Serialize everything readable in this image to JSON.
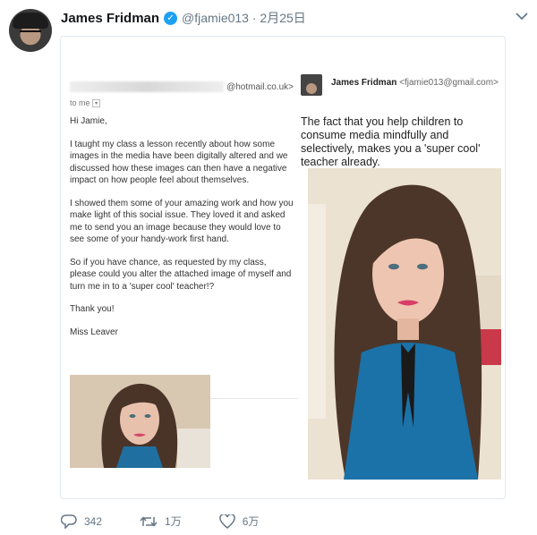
{
  "tweet": {
    "author_name": "James Fridman",
    "handle_date": "@fjamie013 · 2月25日",
    "counts": {
      "replies": "342",
      "retweets": "1万",
      "likes": "6万"
    }
  },
  "email_left": {
    "from_domain": "@hotmail.co.uk>",
    "to_me": "to me",
    "paragraphs": [
      "Hi Jamie,",
      "I taught my class a lesson recently about how some images in the media have been digitally altered and we discussed how these images can then have a negative impact on how people feel about themselves.",
      "I showed them some of your amazing work and how you make light of this social issue. They loved it and asked me to send you an image because they would love to see some of your handy-work first hand.",
      "So if you have chance, as requested by my class, please could you alter the attached image of myself and turn me in to a 'super cool' teacher!?",
      "Thank you!",
      "Miss Leaver"
    ]
  },
  "email_right": {
    "sender_name": "James Fridman",
    "sender_email": "<fjamie013@gmail.com>",
    "reply_text": "The fact that you help children to consume media mindfully and selectively, makes you a 'super cool' teacher already."
  },
  "icons": [
    "verified-badge-icon",
    "chevron-down-icon",
    "reply-icon",
    "retweet-icon",
    "like-icon"
  ],
  "colors": {
    "verified": "#1da1f2",
    "meta_gray": "#657786",
    "card_border": "#e1e8ed"
  }
}
